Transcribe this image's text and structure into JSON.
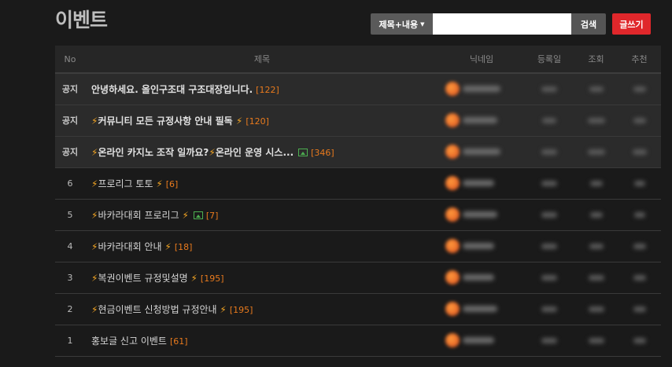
{
  "board": {
    "title": "이벤트"
  },
  "search": {
    "field_label": "제목+내용",
    "value": "",
    "placeholder": "",
    "button_label": "검색"
  },
  "write_button_label": "글쓰기",
  "table": {
    "headers": {
      "no": "No",
      "subject": "제목",
      "nickname": "닉네임",
      "date": "등록일",
      "views": "조회",
      "recommend": "추천"
    },
    "notice_label": "공지",
    "rows": [
      {
        "no": "공지",
        "notice": true,
        "bolt_before": false,
        "subject": "안녕하세요. 올인구조대 구조대장입니다.",
        "bolt_after": false,
        "image": false,
        "comments": "[122]"
      },
      {
        "no": "공지",
        "notice": true,
        "bolt_before": true,
        "subject": "커뮤니티 모든 규정사항 안내 필독",
        "bolt_after": true,
        "image": false,
        "comments": "[120]"
      },
      {
        "no": "공지",
        "notice": true,
        "bolt_before": true,
        "subject": "온라인 카지노 조작 일까요?",
        "bolt_mid": true,
        "subject_tail": "온라인 운영 시스...",
        "bolt_after": false,
        "image": true,
        "comments": "[346]"
      },
      {
        "no": "6",
        "notice": false,
        "bolt_before": true,
        "subject": "프로리그 토토",
        "bolt_after": true,
        "image": false,
        "comments": "[6]"
      },
      {
        "no": "5",
        "notice": false,
        "bolt_before": true,
        "subject": "바카라대회 프로리그",
        "bolt_after": true,
        "image": true,
        "comments": "[7]"
      },
      {
        "no": "4",
        "notice": false,
        "bolt_before": true,
        "subject": "바카라대회 안내",
        "bolt_after": true,
        "image": false,
        "comments": "[18]"
      },
      {
        "no": "3",
        "notice": false,
        "bolt_before": true,
        "subject": "복권이벤트 규정및설명",
        "bolt_after": true,
        "image": false,
        "comments": "[195]"
      },
      {
        "no": "2",
        "notice": false,
        "bolt_before": true,
        "subject": "현금이벤트 신청방법 규정안내",
        "bolt_after": true,
        "image": false,
        "comments": "[195]"
      },
      {
        "no": "1",
        "notice": false,
        "bolt_before": false,
        "subject": "홍보글 신고 이벤트",
        "bolt_after": false,
        "image": false,
        "comments": "[61]"
      }
    ]
  },
  "icons": {
    "bolt": "⚡",
    "caret": "▼"
  },
  "colors": {
    "background": "#1a1a1a",
    "write_button": "#e0272b",
    "comment_count": "#e87a1d",
    "bolt": "#f5a623",
    "image_icon": "#4caf50"
  }
}
